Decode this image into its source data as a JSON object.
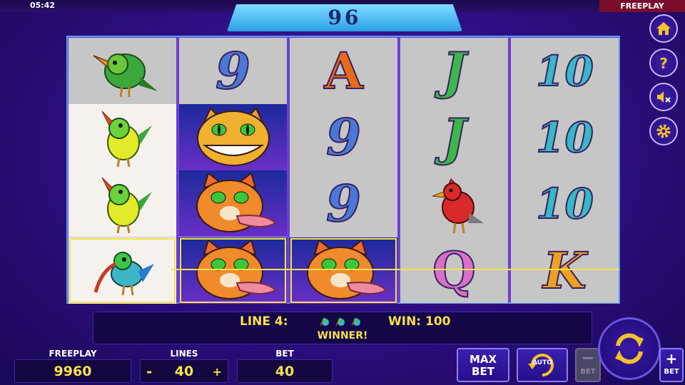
{
  "status": {
    "time": "05:42",
    "mode": "FREEPLAY"
  },
  "counter": "96",
  "reels": [
    [
      "bird-green",
      "bird-yellow",
      "bird-yellow",
      "bird-hummingbird"
    ],
    [
      "9",
      "cat-grin",
      "cat-tongue",
      "cat-tongue"
    ],
    [
      "A",
      "9",
      "9",
      "cat-tongue"
    ],
    [
      "J",
      "J",
      "bird-cardinal",
      "Q"
    ],
    [
      "10",
      "10",
      "10",
      "K"
    ]
  ],
  "win": {
    "line_label": "LINE 4:",
    "win_label": "WIN: 100",
    "message": "WINNER!"
  },
  "stats": {
    "credit_label": "FREEPLAY",
    "credit_value": "9960",
    "lines_label": "LINES",
    "lines_value": "40",
    "lines_minus": "-",
    "lines_plus": "+",
    "bet_label": "BET",
    "bet_value": "40"
  },
  "buttons": {
    "max_bet": "MAX BET",
    "auto": "AUTO",
    "bet_minus": "BET",
    "bet_plus": "BET"
  },
  "side": [
    "home-icon",
    "help-icon",
    "sound-mute-icon",
    "settings-icon"
  ],
  "colors": {
    "accent": "#f4e24a",
    "reel_bg": "#c6c6c6",
    "frame": "#6b3fd6"
  }
}
